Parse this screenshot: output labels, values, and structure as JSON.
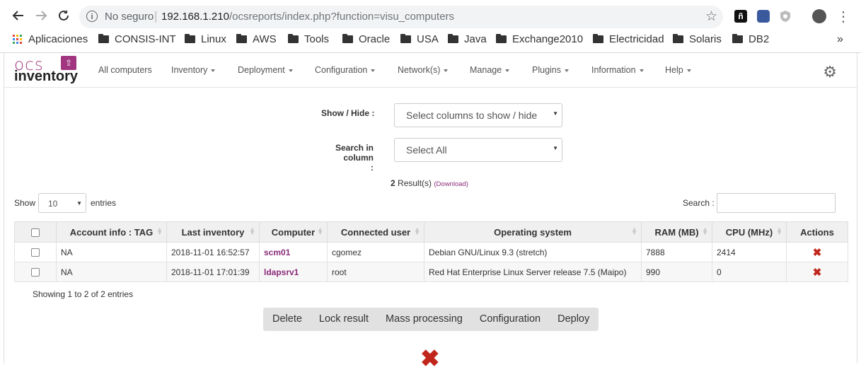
{
  "browser": {
    "security_text": "No seguro",
    "url_host": "192.168.1.210",
    "url_path": "/ocsreports/index.php?function=visu_computers",
    "more_icon": "⋮",
    "bookmarks": [
      {
        "label": "Aplicaciones",
        "type": "apps"
      },
      {
        "label": "CONSIS-INT",
        "type": "folder"
      },
      {
        "label": "Linux",
        "type": "folder"
      },
      {
        "label": "AWS",
        "type": "folder"
      },
      {
        "label": "Tools",
        "type": "folder"
      },
      {
        "label": "Oracle",
        "type": "folder"
      },
      {
        "label": "USA",
        "type": "folder"
      },
      {
        "label": "Java",
        "type": "folder"
      },
      {
        "label": "Exchange2010",
        "type": "folder"
      },
      {
        "label": "Electricidad",
        "type": "folder"
      },
      {
        "label": "Solaris",
        "type": "folder"
      },
      {
        "label": "DB2",
        "type": "folder"
      }
    ],
    "bookmarks_overflow": "»"
  },
  "app": {
    "logo_ocs": "ocs",
    "logo_inventory": "inventory",
    "menu": [
      {
        "label": "All computers",
        "dropdown": false
      },
      {
        "label": "Inventory",
        "dropdown": true
      },
      {
        "label": "Deployment",
        "dropdown": true
      },
      {
        "label": "Configuration",
        "dropdown": true
      },
      {
        "label": "Network(s)",
        "dropdown": true
      },
      {
        "label": "Manage",
        "dropdown": true
      },
      {
        "label": "Plugins",
        "dropdown": true
      },
      {
        "label": "Information",
        "dropdown": true
      },
      {
        "label": "Help",
        "dropdown": true
      }
    ]
  },
  "filters": {
    "show_hide_label": "Show / Hide :",
    "show_hide_value": "Select columns to show / hide",
    "search_col_label_1": "Search in column",
    "search_col_label_2": ":",
    "search_col_value": "Select All"
  },
  "results": {
    "count": "2",
    "label": "Result(s)",
    "download": "(Download)"
  },
  "table_controls": {
    "show": "Show",
    "entries_value": "10",
    "entries": "entries",
    "search_label": "Search :"
  },
  "table": {
    "columns": [
      "Account info : TAG",
      "Last inventory",
      "Computer",
      "Connected user",
      "Operating system",
      "RAM (MB)",
      "CPU (MHz)",
      "Actions"
    ],
    "rows": [
      {
        "tag": "NA",
        "last_inventory": "2018-11-01 16:52:57",
        "computer": "scm01",
        "user": "cgomez",
        "os": "Debian GNU/Linux 9.3 (stretch)",
        "ram": "7888",
        "cpu": "2414"
      },
      {
        "tag": "NA",
        "last_inventory": "2018-11-01 17:01:39",
        "computer": "ldapsrv1",
        "user": "root",
        "os": "Red Hat Enterprise Linux Server release 7.5 (Maipo)",
        "ram": "990",
        "cpu": "0"
      }
    ],
    "info": "Showing 1 to 2 of 2 entries"
  },
  "actions": [
    "Delete",
    "Lock result",
    "Mass processing",
    "Configuration",
    "Deploy"
  ],
  "colors": {
    "brand": "#a1357f",
    "delete": "#c0261b"
  }
}
